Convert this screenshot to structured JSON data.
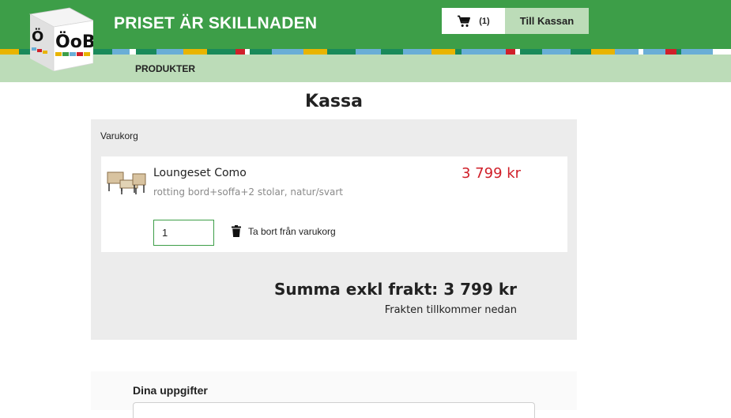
{
  "header": {
    "logo_text": "ÖoB",
    "tagline": "PRISET ÄR SKILLNADEN",
    "cart": {
      "icon": "cart-icon",
      "count": "(1)"
    },
    "checkout_label": "Till Kassan"
  },
  "nav": {
    "items": [
      {
        "label": "PRODUKTER"
      }
    ]
  },
  "colors": {
    "brand_green": "#3d9e48",
    "light_green": "#bcdcb8",
    "price_red": "#d0202a"
  },
  "page": {
    "title": "Kassa"
  },
  "cart": {
    "heading": "Varukorg",
    "items": [
      {
        "name": "Loungeset Como",
        "description": "rotting bord+soffa+2 stolar, natur/svart",
        "price": "3 799 kr",
        "quantity": "1",
        "remove_label": "Ta bort från varukorg",
        "remove_icon": "trash-icon"
      }
    ],
    "sum_label": "Summa exkl frakt: 3 799 kr",
    "freight_note": "Frakten tillkommer nedan"
  },
  "details": {
    "heading": "Dina uppgifter"
  }
}
